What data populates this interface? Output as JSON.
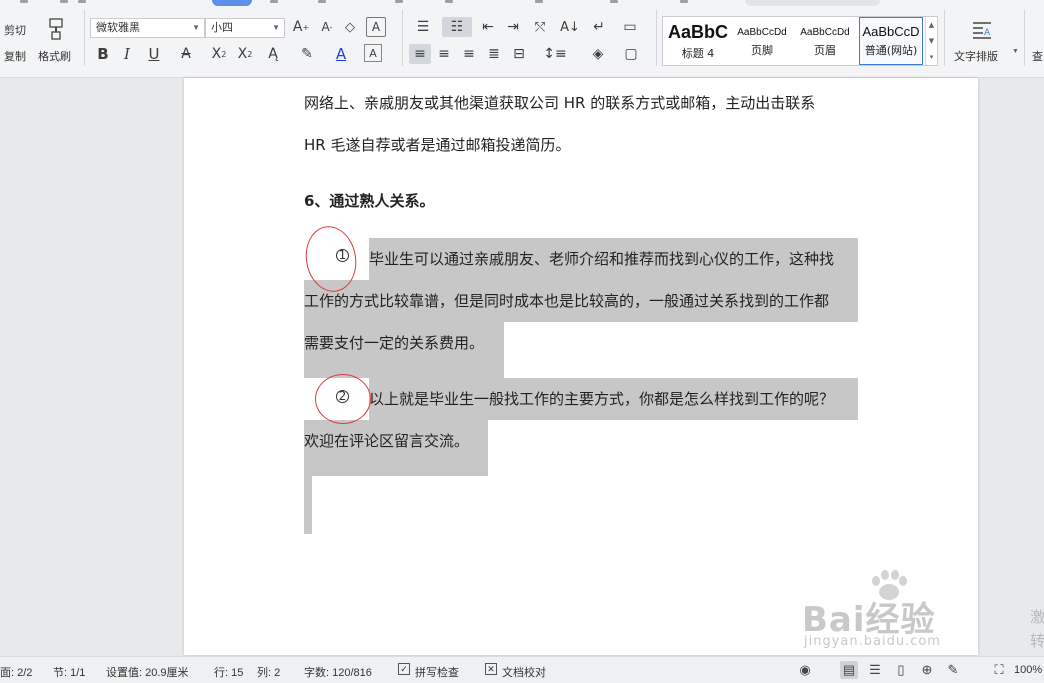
{
  "ribbon": {
    "clipboard": {
      "cut": "剪切",
      "copy": "复制",
      "format_painter": "格式刷"
    },
    "font": {
      "family": "微软雅黑",
      "size": "小四"
    },
    "styles": [
      {
        "sample": "AaBbC",
        "name": "标题 4"
      },
      {
        "sample": "AaBbCcDd",
        "name": "页脚"
      },
      {
        "sample": "AaBbCcDd",
        "name": "页眉"
      },
      {
        "sample": "AaBbCcD",
        "name": "普通(网站)"
      }
    ],
    "text_layout": "文字排版",
    "find": "查"
  },
  "document": {
    "line1": "网络上、亲戚朋友或其他渠道获取公司 HR 的联系方式或邮箱，主动出击联系",
    "line2": "HR 毛遂自荐或者是通过邮箱投递简历。",
    "heading": "6、通过熟人关系。",
    "p1_marker": "1",
    "p1_line1": "毕业生可以通过亲戚朋友、老师介绍和推荐而找到心仪的工作，这种找",
    "p1_line2": "工作的方式比较靠谱，但是同时成本也是比较高的，一般通过关系找到的工作都",
    "p1_line3": "需要支付一定的关系费用。",
    "p2_marker": "2",
    "p2_line1": "以上就是毕业生一般找工作的主要方式，你都是怎么样找到工作的呢？",
    "p2_line2": "欢迎在评论区留言交流。"
  },
  "watermark": {
    "brand": "Bai经验",
    "url": "jingyan.baidu.com"
  },
  "right_hint": [
    "激",
    "转"
  ],
  "status": {
    "page": "面: 2/2",
    "section": "节: 1/1",
    "setting": "设置值: 20.9厘米",
    "row": "行: 15",
    "col": "列: 2",
    "words": "字数: 120/816",
    "spell": "拼写检查",
    "proof": "文档校对",
    "zoom": "100%"
  },
  "colors": {
    "highlight": "#c7c7c7",
    "circle": "#e0393a",
    "accent": "#5b8fe8"
  }
}
